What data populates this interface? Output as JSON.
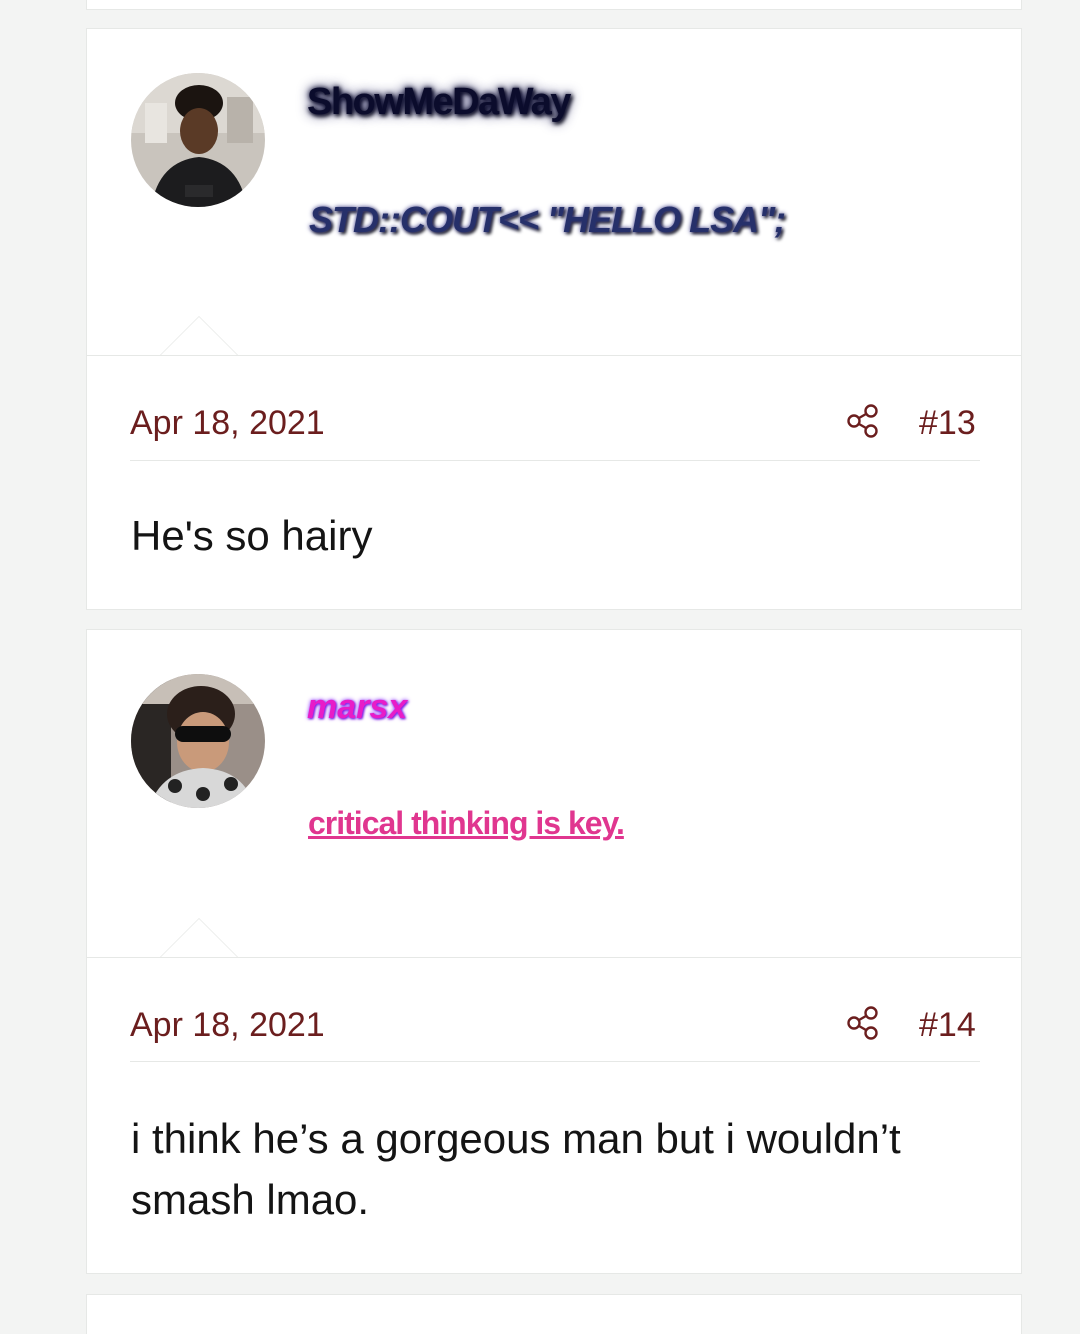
{
  "posts": [
    {
      "username": "ShowMeDaWay",
      "user_title": "STD::COUT<< \"HELLO LSA\";",
      "date": "Apr 18, 2021",
      "share_icon": "share-icon",
      "post_number": "#13",
      "body": "He's so hairy"
    },
    {
      "username": "marsx",
      "user_title": "critical thinking is key.",
      "date": "Apr 18, 2021",
      "share_icon": "share-icon",
      "post_number": "#14",
      "body": "i think he’s a gorgeous man but i wouldn’t smash lmao."
    }
  ],
  "colors": {
    "page_background": "#f3f4f3",
    "card_background": "#ffffff",
    "meta_text": "#6b1e1e",
    "username_1": "#0b0c2c",
    "title_1": "#26306a",
    "username_2": "#e81cc8",
    "title_2": "#e0368f"
  }
}
